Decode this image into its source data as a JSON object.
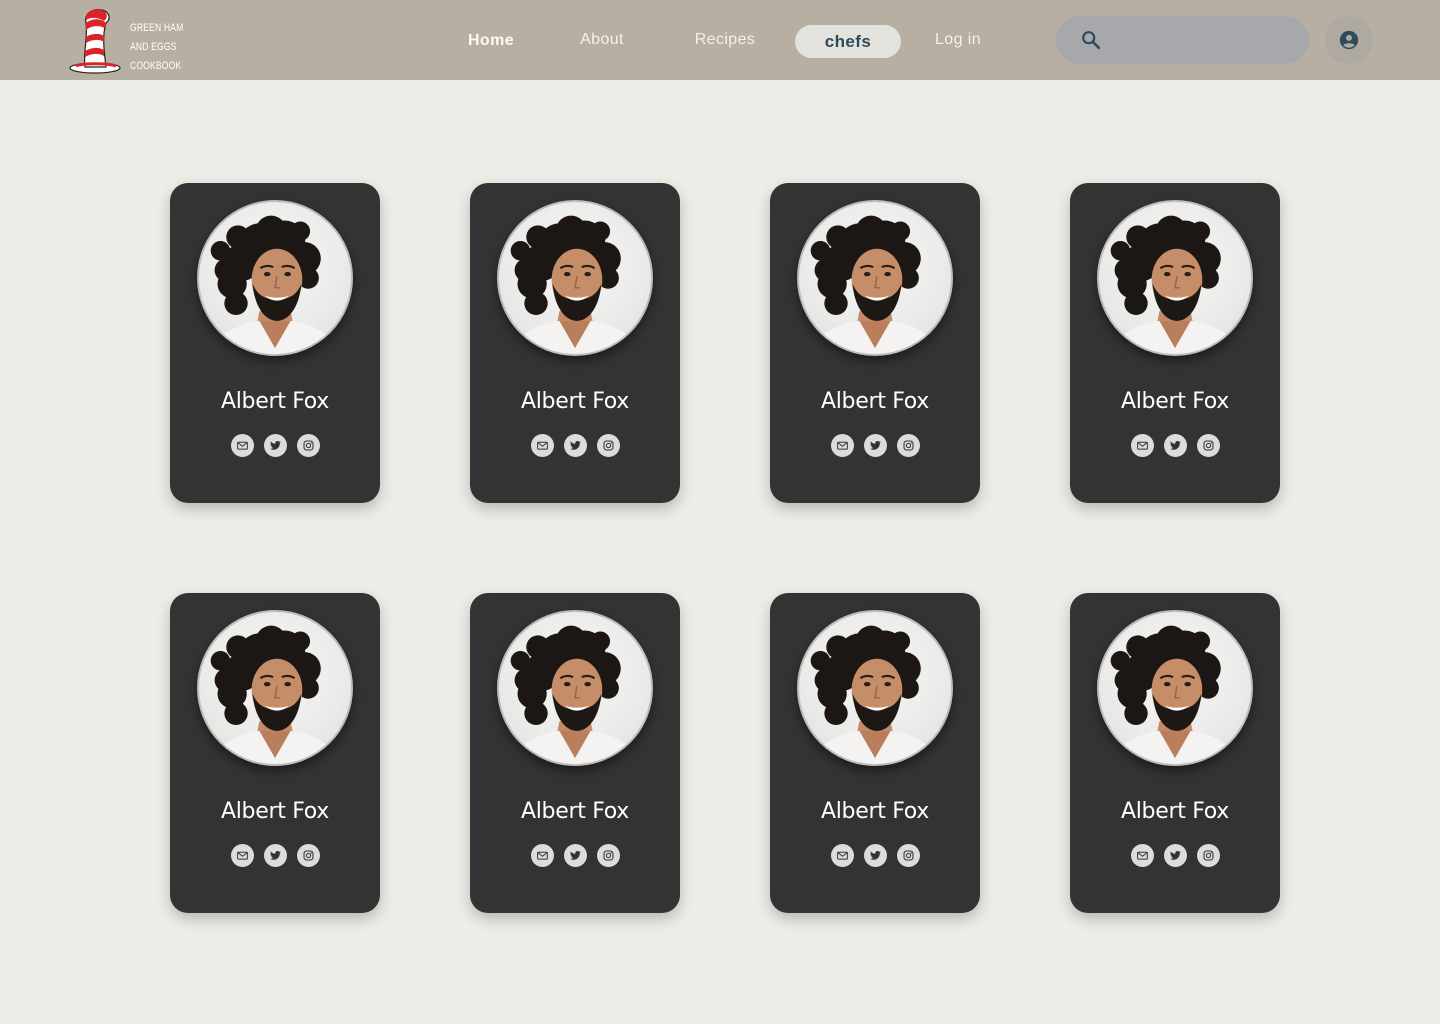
{
  "brand": {
    "logo_lines": [
      "GREEN HAM",
      "AND EGGS",
      "COOKBOOK"
    ]
  },
  "nav": {
    "items": [
      {
        "label": "Home",
        "active": false
      },
      {
        "label": "About",
        "active": false
      },
      {
        "label": "Recipes",
        "active": false
      },
      {
        "label": "chefs",
        "active": true
      },
      {
        "label": "Log in",
        "active": false
      }
    ]
  },
  "search": {
    "value": "",
    "placeholder": "",
    "icon": "search-icon"
  },
  "account": {
    "icon": "account-circle-icon"
  },
  "chefs": [
    {
      "name": "Albert Fox",
      "socials": [
        "mail-icon",
        "twitter-icon",
        "instagram-icon"
      ]
    },
    {
      "name": "Albert Fox",
      "socials": [
        "mail-icon",
        "twitter-icon",
        "instagram-icon"
      ]
    },
    {
      "name": "Albert Fox",
      "socials": [
        "mail-icon",
        "twitter-icon",
        "instagram-icon"
      ]
    },
    {
      "name": "Albert Fox",
      "socials": [
        "mail-icon",
        "twitter-icon",
        "instagram-icon"
      ]
    },
    {
      "name": "Albert Fox",
      "socials": [
        "mail-icon",
        "twitter-icon",
        "instagram-icon"
      ]
    },
    {
      "name": "Albert Fox",
      "socials": [
        "mail-icon",
        "twitter-icon",
        "instagram-icon"
      ]
    },
    {
      "name": "Albert Fox",
      "socials": [
        "mail-icon",
        "twitter-icon",
        "instagram-icon"
      ]
    },
    {
      "name": "Albert Fox",
      "socials": [
        "mail-icon",
        "twitter-icon",
        "instagram-icon"
      ]
    }
  ],
  "colors": {
    "navbar": "#B6AFA2",
    "page_background": "#EDECE7",
    "card": "#333333",
    "active_tab_bg": "#E4E2DC",
    "active_tab_text": "#2E4C5A",
    "search_bg": "#A6A8AC",
    "social_bg": "#DCDCDC",
    "icon_dark": "#2E4C5A"
  }
}
